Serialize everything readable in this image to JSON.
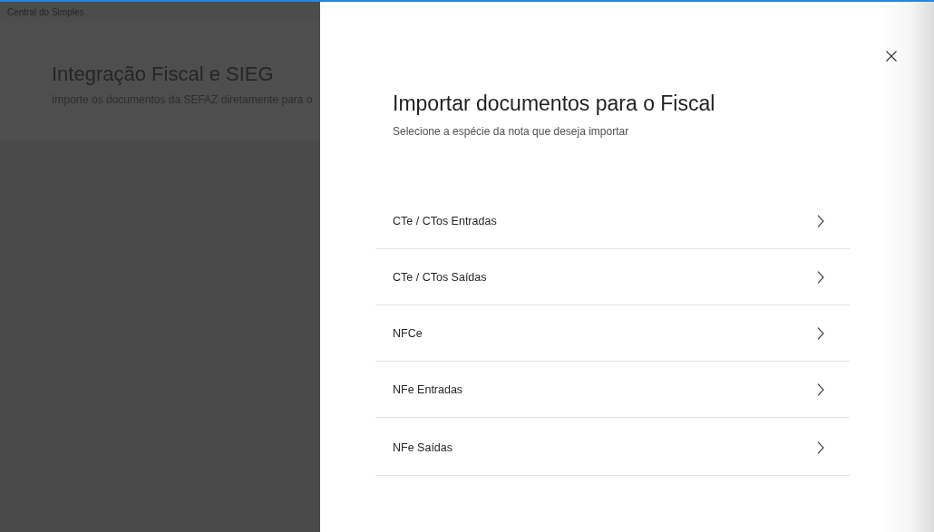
{
  "app_bar": {
    "title": "Central do Simples"
  },
  "page": {
    "title": "Integração Fiscal e SIEG",
    "subtitle": "Importe os documentos da SEFAZ diretamente para o"
  },
  "panel": {
    "title": "Importar documentos para o Fiscal",
    "subtitle": "Selecione a espécie da nota que deseja importar",
    "items": [
      {
        "label": "CTe / CTos Entradas"
      },
      {
        "label": "CTe / CTos Saídas"
      },
      {
        "label": "NFCe"
      },
      {
        "label": "NFe Entradas"
      },
      {
        "label": "NFe Saídas"
      }
    ]
  }
}
